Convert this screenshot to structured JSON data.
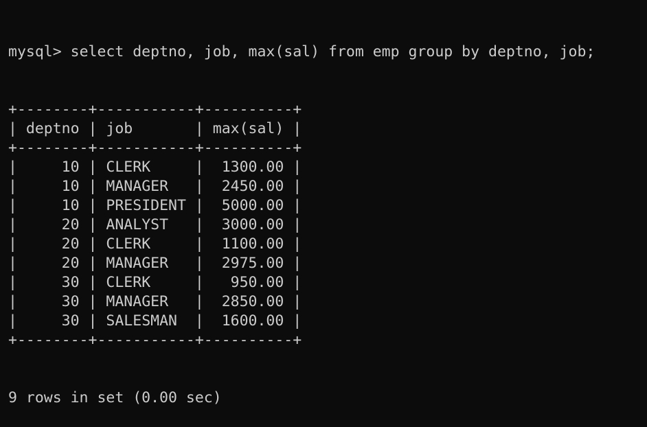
{
  "terminal": {
    "prompt": "mysql>",
    "command": "select deptno, job, max(sal) from emp group by deptno, job;",
    "table": {
      "headers": [
        "deptno",
        "job",
        "max(sal)"
      ],
      "rows": [
        [
          "10",
          "CLERK",
          "1300.00"
        ],
        [
          "10",
          "MANAGER",
          "2450.00"
        ],
        [
          "10",
          "PRESIDENT",
          "5000.00"
        ],
        [
          "20",
          "ANALYST",
          "3000.00"
        ],
        [
          "20",
          "CLERK",
          "1100.00"
        ],
        [
          "20",
          "MANAGER",
          "2975.00"
        ],
        [
          "30",
          "CLERK",
          "950.00"
        ],
        [
          "30",
          "MANAGER",
          "2850.00"
        ],
        [
          "30",
          "SALESMAN",
          "1600.00"
        ]
      ]
    },
    "summary": "9 rows in set (0.00 sec)"
  },
  "colors": {
    "background": "#0c0c0c",
    "text": "#cccccc"
  }
}
